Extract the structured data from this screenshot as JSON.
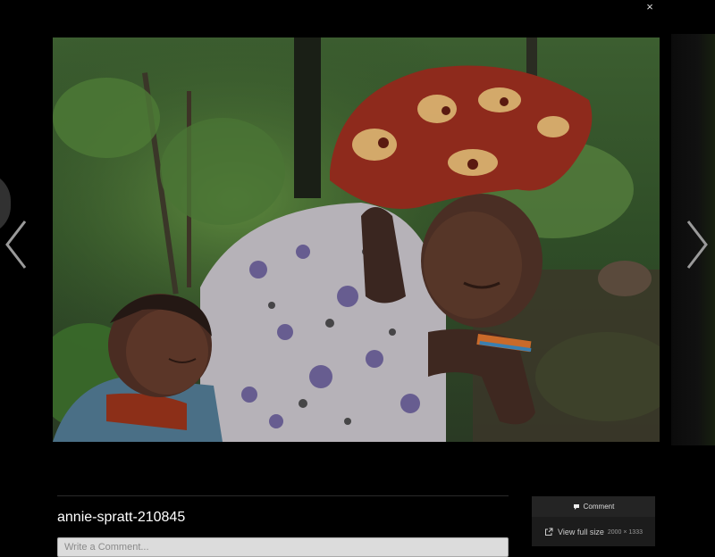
{
  "viewer": {
    "close_symbol": "×",
    "prev_arrow": "chevron-left-icon",
    "next_arrow": "chevron-right-icon"
  },
  "photo": {
    "alt": "Woman in patterned head wrap carrying a sleeping baby on her back in a green field"
  },
  "details": {
    "title": "annie-spratt-210845",
    "comment_placeholder": "Write a Comment..."
  },
  "actions": {
    "comment_label": "Comment",
    "comment_icon": "speech-bubble-icon",
    "view_full_size_label": "View full size",
    "view_full_size_icon": "external-link-icon",
    "dimensions": "2000 × 1333"
  },
  "colors": {
    "background": "#000000",
    "panel": "#1c1c1c",
    "text": "#ffffff"
  }
}
